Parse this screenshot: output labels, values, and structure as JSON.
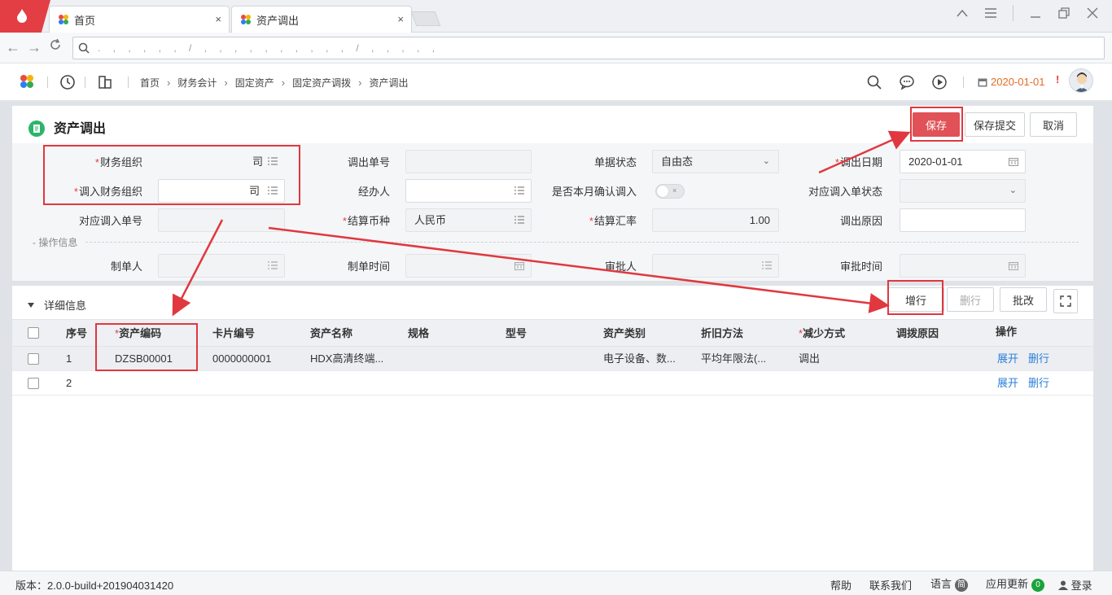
{
  "browser": {
    "tabs": [
      {
        "label": "首页",
        "close": "×"
      },
      {
        "label": "资产调出",
        "close": "×"
      }
    ],
    "url_text": ". , , , , , / , , , , , , , , , , / , , , , ,",
    "window_controls": [
      "menu-lines-icon",
      "minimize-icon",
      "restore-icon",
      "close-icon"
    ]
  },
  "header": {
    "breadcrumb": [
      "首页",
      "财务会计",
      "固定资产",
      "固定资产调拨",
      "资产调出"
    ],
    "date": "2020-01-01",
    "alert_mark": "!",
    "icons": [
      "clock-icon",
      "org-icon",
      "search-icon",
      "message-icon",
      "play-icon",
      "calendar-icon"
    ]
  },
  "page": {
    "title": "资产调出",
    "buttons": {
      "save": "保存",
      "save_submit": "保存提交",
      "cancel": "取消"
    }
  },
  "form": {
    "finance_org": {
      "label": "财务组织",
      "value": "司"
    },
    "in_finance_org": {
      "label": "调入财务组织",
      "value": "司"
    },
    "related_in_no": {
      "label": "对应调入单号",
      "value": ""
    },
    "out_no": {
      "label": "调出单号",
      "value": ""
    },
    "handler": {
      "label": "经办人",
      "value": ""
    },
    "currency": {
      "label": "结算币种",
      "value": "人民币"
    },
    "doc_status": {
      "label": "单据状态",
      "value": "自由态"
    },
    "confirm_month": {
      "label": "是否本月确认调入",
      "value": "×"
    },
    "rate": {
      "label": "结算汇率",
      "value": "1.00"
    },
    "out_date": {
      "label": "调出日期",
      "value": "2020-01-01"
    },
    "related_in_status": {
      "label": "对应调入单状态",
      "value": ""
    },
    "out_reason": {
      "label": "调出原因",
      "value": ""
    },
    "ops_section": "- 操作信息",
    "creator": {
      "label": "制单人",
      "value": ""
    },
    "create_time": {
      "label": "制单时间",
      "value": ""
    },
    "approver": {
      "label": "审批人",
      "value": ""
    },
    "approve_time": {
      "label": "审批时间",
      "value": ""
    }
  },
  "detail": {
    "toggle_label": "详细信息",
    "buttons": {
      "add_row": "增行",
      "delete_row": "删行",
      "batch_edit": "批改"
    },
    "columns": [
      "序号",
      "资产编码",
      "卡片编号",
      "资产名称",
      "规格",
      "型号",
      "资产类别",
      "折旧方法",
      "减少方式",
      "调拨原因",
      "操作"
    ],
    "rows": [
      {
        "no": "1",
        "asset_code": "DZSB00001",
        "card_no": "0000000001",
        "asset_name": "HDX高清终端...",
        "spec": "",
        "model": "",
        "category": "电子设备、数...",
        "method": "平均年限法(...",
        "reduce": "调出",
        "reason": "",
        "op_expand": "展开",
        "op_delete": "删行"
      },
      {
        "no": "2",
        "asset_code": "",
        "card_no": "",
        "asset_name": "",
        "spec": "",
        "model": "",
        "category": "",
        "method": "",
        "reduce": "",
        "reason": "",
        "op_expand": "展开",
        "op_delete": "删行"
      }
    ]
  },
  "footer": {
    "version": "版本：2.0.0-build+201904031420",
    "help": "帮助",
    "contact": "联系我们",
    "language": "语言",
    "language_badge": "简",
    "updates": "应用更新",
    "updates_count": "0",
    "login": "登录"
  },
  "colors": {
    "accent_red": "#e05257",
    "link_blue": "#2c7fd9",
    "brand_red": "#e23e44",
    "date_orange": "#e46b24"
  }
}
